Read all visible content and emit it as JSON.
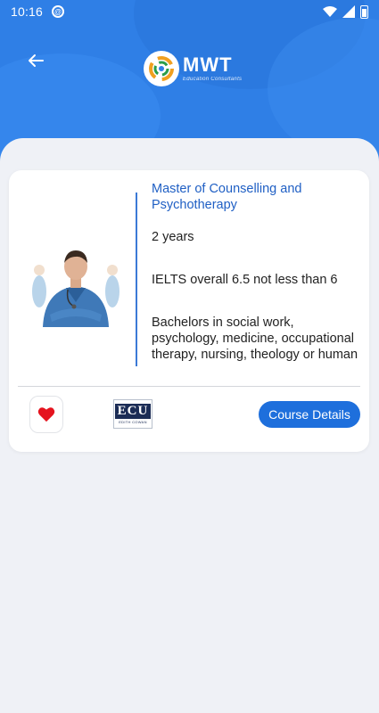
{
  "status_bar": {
    "time": "10:16"
  },
  "header": {
    "logo_text": "MWT",
    "logo_tagline": "Education Consultants"
  },
  "course": {
    "title": "Master of Counselling and Psychotherapy",
    "duration": "2 years",
    "english_requirement": "IELTS overall 6.5 not less than 6",
    "entry_requirement": "Bachelors in social work, psychology, medicine, occupational therapy, nursing, theology or human",
    "university_logo_text": "ECU",
    "university_logo_subtext": "EDITH COWAN",
    "details_button_label": "Course Details"
  },
  "colors": {
    "header_blue": "#2f7fe6",
    "accent_blue": "#1e6fdc",
    "title_blue": "#1f5fc4",
    "favorite_red": "#e5131e",
    "background": "#eff1f6"
  },
  "icons": {
    "back": "arrow-left-icon",
    "favorite": "heart-icon",
    "wifi": "wifi-icon",
    "signal": "signal-icon",
    "battery": "battery-icon"
  }
}
